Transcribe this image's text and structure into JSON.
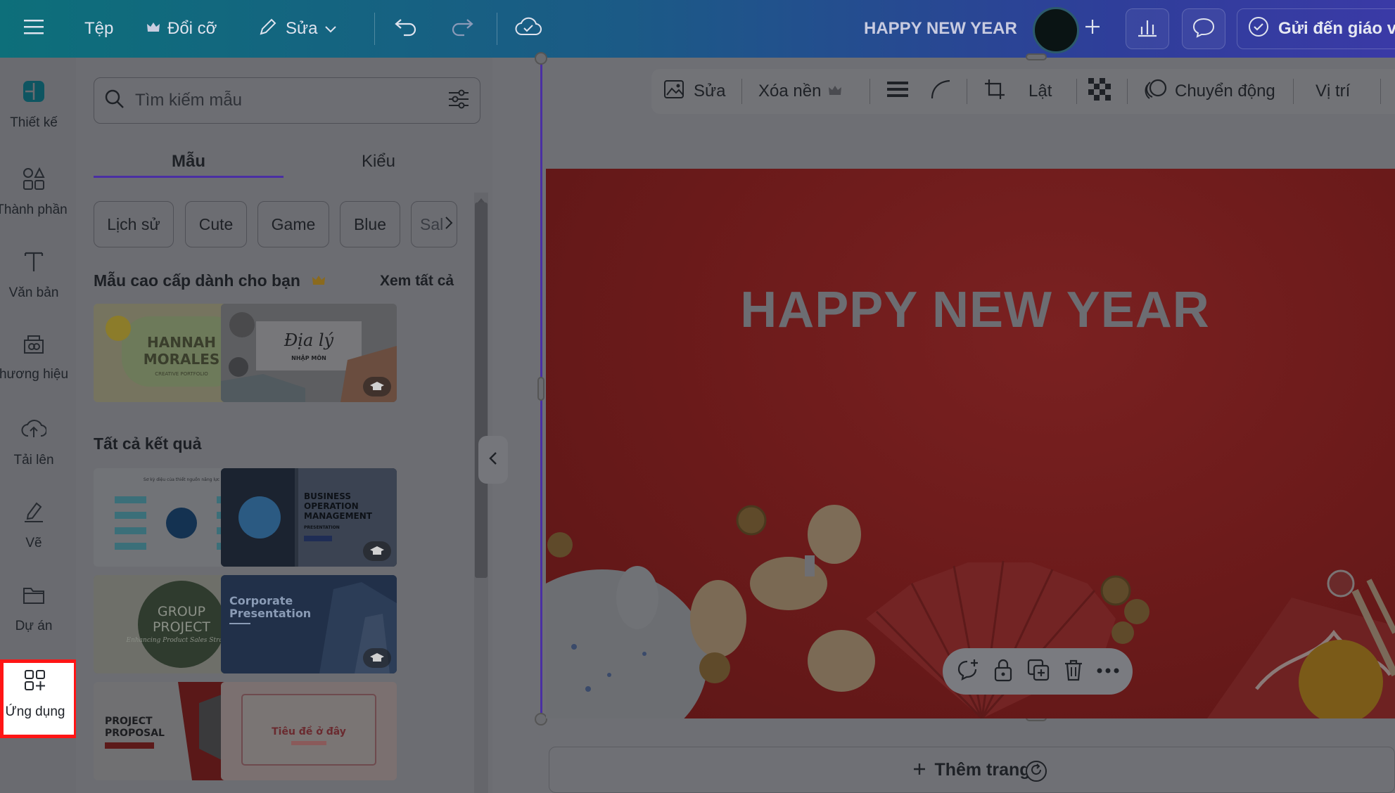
{
  "topbar": {
    "file_label": "Tệp",
    "resize_label": "Đổi cỡ",
    "edit_label": "Sửa",
    "doc_title": "HAPPY NEW YEAR",
    "send_label": "Gửi đến giáo v"
  },
  "rail": {
    "items": [
      {
        "label": "Thiết kế",
        "icon": "design-icon"
      },
      {
        "label": "Thành phần",
        "icon": "elements-icon"
      },
      {
        "label": "Văn bản",
        "icon": "text-icon"
      },
      {
        "label": "hương hiệu",
        "icon": "brand-icon"
      },
      {
        "label": "Tải lên",
        "icon": "upload-icon"
      },
      {
        "label": "Vẽ",
        "icon": "draw-icon"
      },
      {
        "label": "Dự án",
        "icon": "folder-icon"
      },
      {
        "label": "Ứng dụng",
        "icon": "apps-icon"
      }
    ]
  },
  "panel": {
    "search_placeholder": "Tìm kiếm mẫu",
    "tabs": [
      "Mẫu",
      "Kiểu"
    ],
    "chips": [
      "Lịch sử",
      "Cute",
      "Game",
      "Blue",
      "Sal"
    ],
    "premium_title": "Mẫu cao cấp dành cho bạn",
    "see_all": "Xem tất cả",
    "all_results_title": "Tất cả kết quả",
    "premium_thumbs": [
      {
        "line1": "HANNAH",
        "line2": "MORALES",
        "line3": "CREATIVE PORTFOLIO"
      },
      {
        "line1": "Địa lý",
        "line2": "NHẬP MÔN"
      }
    ],
    "result_thumbs": [
      {
        "title": "Sơ kỳ diệu của thiết nguồn năng lực"
      },
      {
        "title": "BUSINESS OPERATION MANAGEMENT",
        "subtitle": "PRESENTATION"
      },
      {
        "title": "GROUP PROJECT",
        "subtitle": "Enhancing Product Sales Strategy"
      },
      {
        "title": "Corporate Presentation"
      },
      {
        "title": "PROJECT PROPOSAL"
      },
      {
        "title": "Tiêu đề ở đây"
      }
    ]
  },
  "context_toolbar": {
    "edit": "Sửa",
    "remove_bg": "Xóa nền",
    "flip": "Lật",
    "animate": "Chuyển động",
    "position": "Vị trí"
  },
  "slide": {
    "title": "HAPPY NEW YEAR"
  },
  "add_page_label": "Thêm trang"
}
